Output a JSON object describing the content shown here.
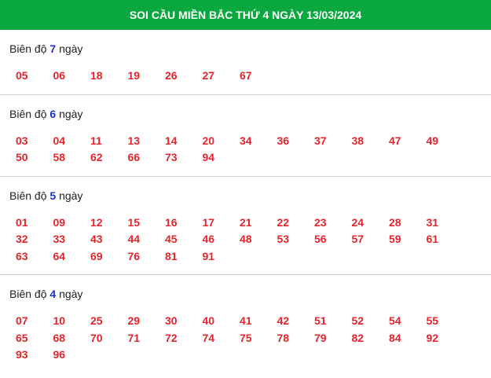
{
  "header": {
    "title": "SOI CẦU MIỀN BẮC THỨ 4 NGÀY 13/03/2024"
  },
  "sections": [
    {
      "prefix": "Biên độ",
      "days": "7",
      "suffix": "ngày",
      "numbers": [
        "05",
        "06",
        "18",
        "19",
        "26",
        "27",
        "67"
      ]
    },
    {
      "prefix": "Biên độ",
      "days": "6",
      "suffix": "ngày",
      "numbers": [
        "03",
        "04",
        "11",
        "13",
        "14",
        "20",
        "34",
        "36",
        "37",
        "38",
        "47",
        "49",
        "50",
        "58",
        "62",
        "66",
        "73",
        "94"
      ]
    },
    {
      "prefix": "Biên độ",
      "days": "5",
      "suffix": "ngày",
      "numbers": [
        "01",
        "09",
        "12",
        "15",
        "16",
        "17",
        "21",
        "22",
        "23",
        "24",
        "28",
        "31",
        "32",
        "33",
        "43",
        "44",
        "45",
        "46",
        "48",
        "53",
        "56",
        "57",
        "59",
        "61",
        "63",
        "64",
        "69",
        "76",
        "81",
        "91"
      ]
    },
    {
      "prefix": "Biên độ",
      "days": "4",
      "suffix": "ngày",
      "numbers": [
        "07",
        "10",
        "25",
        "29",
        "30",
        "40",
        "41",
        "42",
        "51",
        "52",
        "54",
        "55",
        "65",
        "68",
        "70",
        "71",
        "72",
        "74",
        "75",
        "78",
        "79",
        "82",
        "84",
        "92",
        "93",
        "96"
      ]
    }
  ]
}
